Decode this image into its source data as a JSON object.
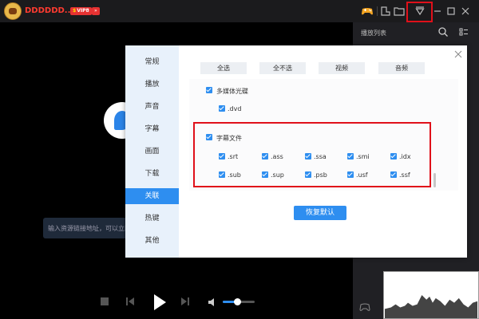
{
  "titlebar": {
    "user_name": "DDDDDD...",
    "vip_badge": "VIP8",
    "badge2": "»"
  },
  "playlist": {
    "title": "播放列表"
  },
  "video": {
    "url_placeholder": "输入资源链接地址，可以立即"
  },
  "dialog": {
    "nav": [
      "常规",
      "播放",
      "声音",
      "字幕",
      "画面",
      "下载",
      "关联",
      "热键",
      "其他"
    ],
    "active_nav": "关联",
    "select_buttons": [
      "全选",
      "全不选",
      "视频",
      "音频"
    ],
    "groups": [
      {
        "label": "多媒体光碟",
        "items": [
          ".dvd"
        ]
      },
      {
        "label": "字幕文件",
        "items": [
          ".srt",
          ".ass",
          ".ssa",
          ".smi",
          ".idx",
          ".sub",
          ".sup",
          ".psb",
          ".usf",
          ".ssf"
        ]
      }
    ],
    "restore_button": "恢复默认"
  },
  "volume": {
    "level": 0.45
  },
  "colors": {
    "accent": "#2e8ef0",
    "highlight": "#e0101a",
    "nav_bg": "#e8f1fb"
  },
  "icons": [
    "gamepad-icon",
    "skin-icon",
    "folder-icon",
    "dropdown-icon",
    "minimize-icon",
    "maximize-icon",
    "close-icon",
    "search-icon",
    "list-icon",
    "stop-icon",
    "prev-icon",
    "play-icon",
    "next-icon",
    "volume-icon"
  ]
}
